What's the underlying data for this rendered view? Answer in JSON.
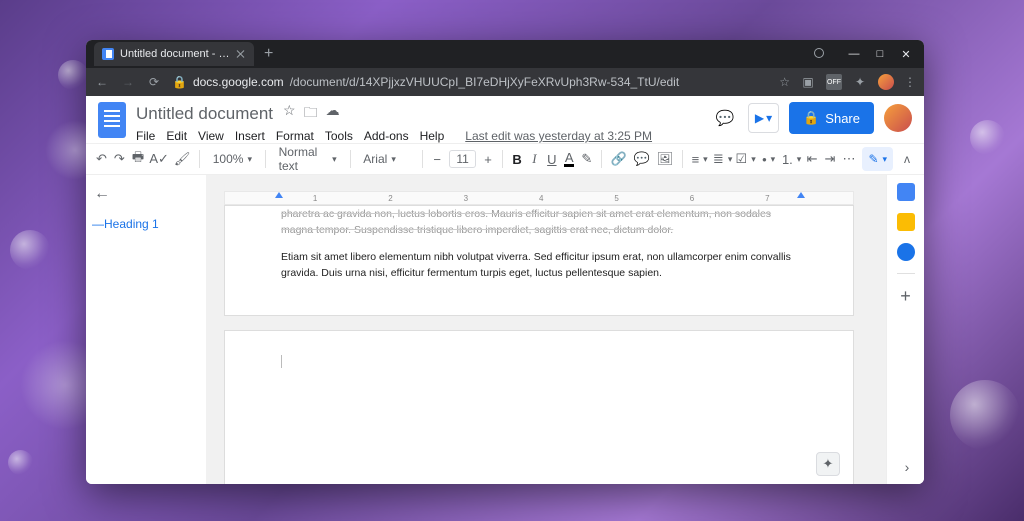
{
  "window": {
    "tab_title": "Untitled document - Google Doc",
    "new_tab_label": "+",
    "minimize": "—",
    "maximize": "□",
    "close": "✕"
  },
  "address": {
    "back": "←",
    "forward": "→",
    "reload": "⟳",
    "lock": "🔒",
    "host": "docs.google.com",
    "path": "/document/d/14XPjjxzVHUUCpI_BI7eDHjXyFeXRvUph3Rw-534_TtU/edit",
    "star": "☆",
    "ext_tag": "▣",
    "ext_off": "OFF",
    "ext_puzzle": "✦",
    "menu": "⋮"
  },
  "header": {
    "doc_title": "Untitled document",
    "star": "☆",
    "move": "🗀",
    "cloud": "☁",
    "menus": [
      "File",
      "Edit",
      "View",
      "Insert",
      "Format",
      "Tools",
      "Add-ons",
      "Help"
    ],
    "last_edit": "Last edit was yesterday at 3:25 PM",
    "comments": "💬",
    "present": "▶",
    "present_dd": "▾",
    "share_icon": "🔒",
    "share_label": "Share"
  },
  "toolbar": {
    "undo": "↶",
    "redo": "↷",
    "print": "🖶",
    "spell": "A✓",
    "paint": "🖌",
    "zoom": "100%",
    "style": "Normal text",
    "font": "Arial",
    "size_minus": "−",
    "size": "11",
    "size_plus": "+",
    "bold": "B",
    "italic": "I",
    "underline": "U",
    "color": "A",
    "highlight": "✎",
    "link": "🔗",
    "comment": "💬",
    "image": "🖼",
    "align": "≡",
    "linesp": "≣",
    "checklist": "☑",
    "bullets": "•",
    "numbers": "1.",
    "indent_out": "⇤",
    "indent_in": "⇥",
    "clear": "⋯",
    "edit_mode": "✎",
    "collapse": "ʌ"
  },
  "outline": {
    "back": "←",
    "heading": "Heading 1"
  },
  "ruler": {
    "ticks": [
      "1",
      "2",
      "3",
      "4",
      "5",
      "6",
      "7"
    ]
  },
  "document": {
    "para1": "pharetra ac gravida non, luctus lobortis eros. Mauris efficitur sapien sit amet erat elementum, non sodales magna tempor. Suspendisse tristique libero imperdiet, sagittis erat nec, dictum dolor.",
    "para2": "Etiam sit amet libero elementum nibh volutpat viverra. Sed efficitur ipsum erat, non ullamcorper enim convallis gravida. Duis urna nisi, efficitur fermentum turpis eget, luctus pellentesque sapien."
  },
  "companion": {
    "calendar": "#4285f4",
    "keep": "#fbbc04",
    "tasks": "#1a73e8",
    "add": "+"
  },
  "explore": "✦",
  "hide_panel": "›"
}
